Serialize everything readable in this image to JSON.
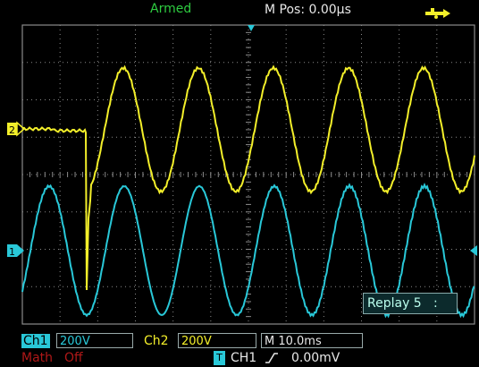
{
  "top_bar": {
    "status": "Armed",
    "m_pos": "M Pos: 0.00µs",
    "usb_icon": "usb-icon"
  },
  "colors": {
    "ch1": "#29c8d8",
    "ch2": "#f3ef2a",
    "grid": "#8a8a8a",
    "status": "#2ecc40",
    "math": "#b01818"
  },
  "markers": {
    "ch2": "2",
    "ch1": "1"
  },
  "replay": {
    "label": "Replay 5",
    "suffix": ":"
  },
  "bottom_bar": {
    "ch1_label": "Ch1",
    "ch1_scale": "200V",
    "ch2_label": "Ch2",
    "ch2_scale": "200V",
    "timebase": "M 10.0ms",
    "math_label": "Math",
    "math_state": "Off",
    "trigger_icon": "T",
    "trigger_source": "CH1",
    "trigger_level": "0.00mV"
  }
}
